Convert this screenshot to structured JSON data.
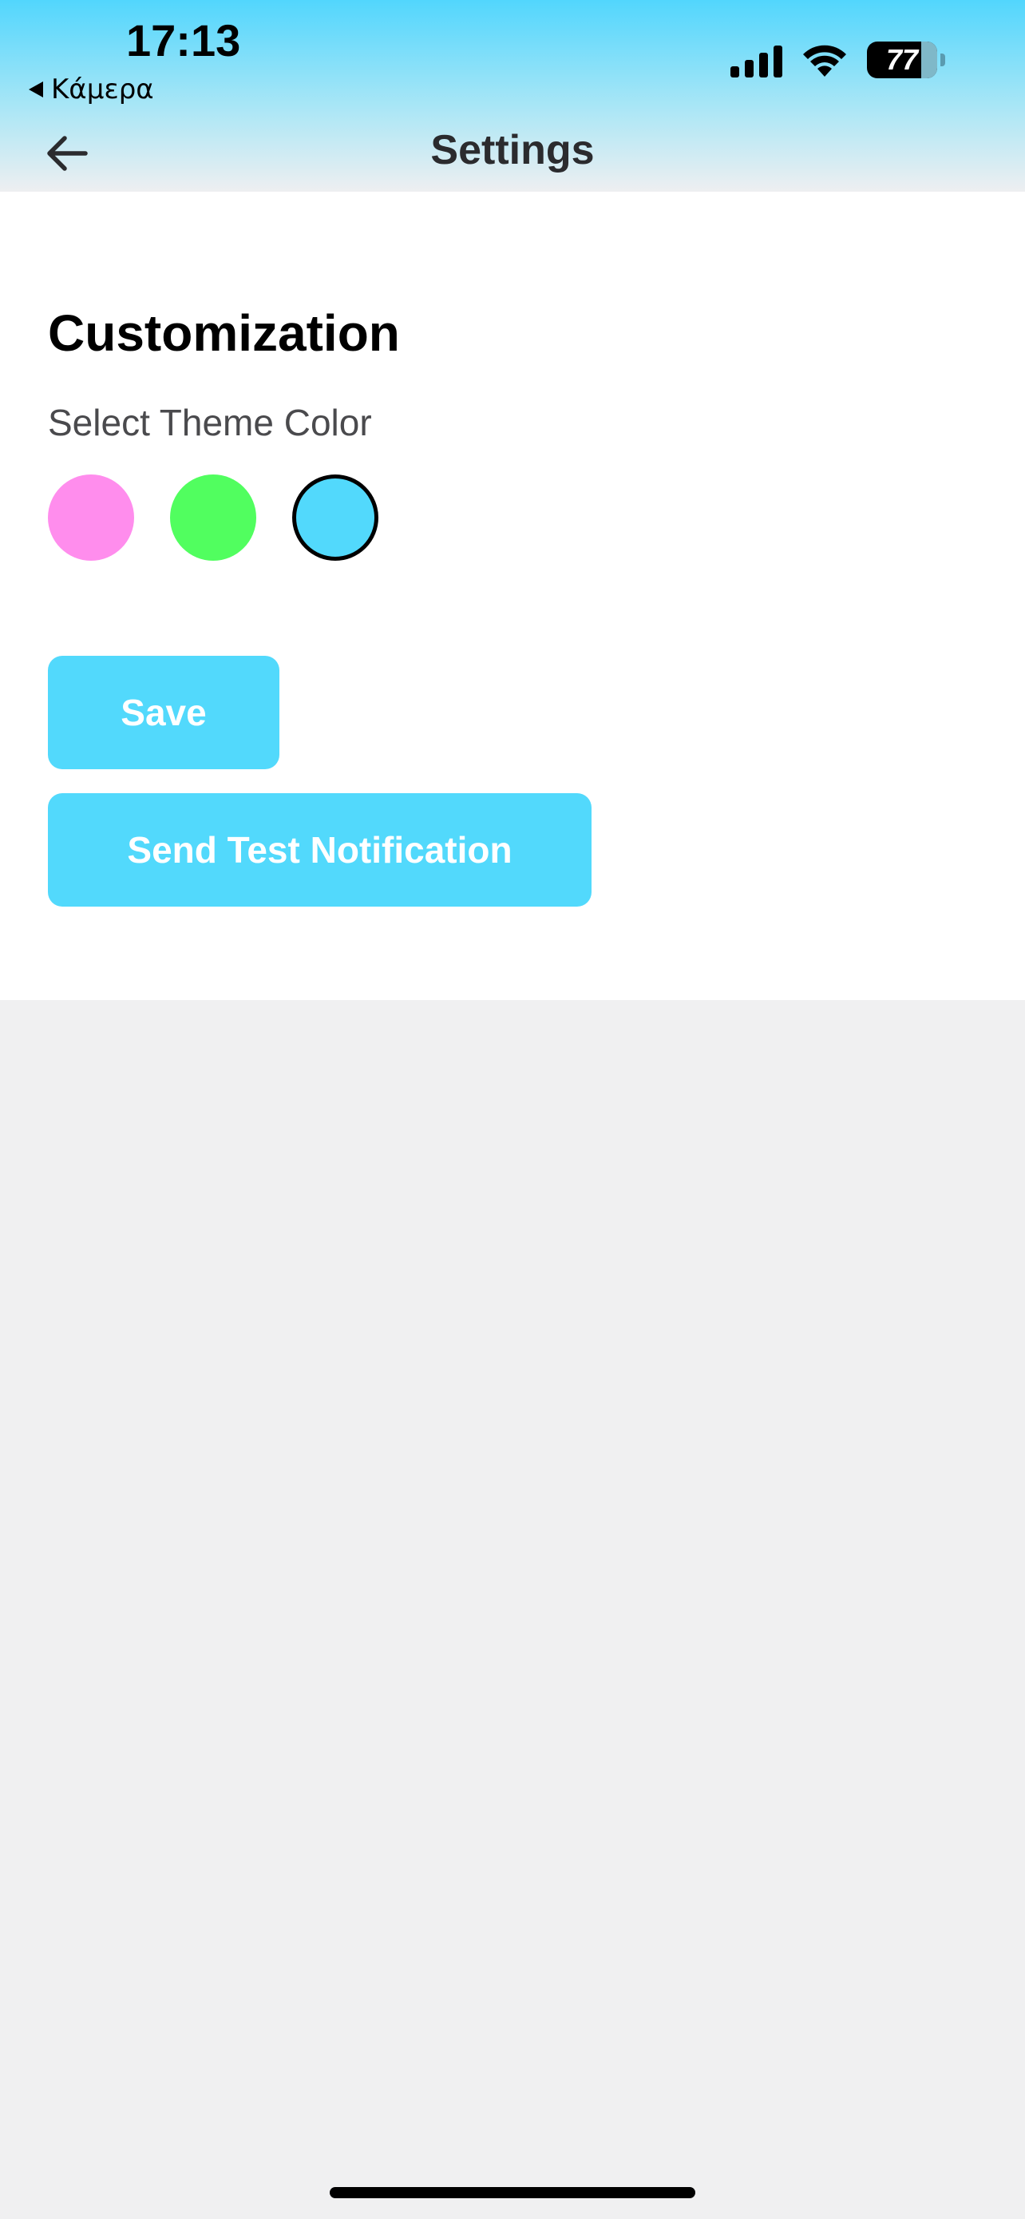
{
  "status_bar": {
    "time": "17:13",
    "back_app_label": "Κάμερα",
    "battery_percent": "77",
    "signal_bars": 4
  },
  "nav": {
    "title": "Settings",
    "back_icon": "arrow-left-icon"
  },
  "customization": {
    "title": "Customization",
    "theme_label": "Select Theme Color",
    "swatches": [
      {
        "name": "pink",
        "color": "#ff8ded",
        "selected": false
      },
      {
        "name": "green",
        "color": "#51fe5f",
        "selected": false
      },
      {
        "name": "cyan",
        "color": "#52d9fc",
        "selected": true
      }
    ]
  },
  "actions": {
    "save_label": "Save",
    "test_notification_label": "Send Test Notification",
    "button_color": "#52d9fc"
  },
  "colors": {
    "accent": "#52d9fc",
    "background": "#f0f0f1",
    "card": "#ffffff"
  }
}
